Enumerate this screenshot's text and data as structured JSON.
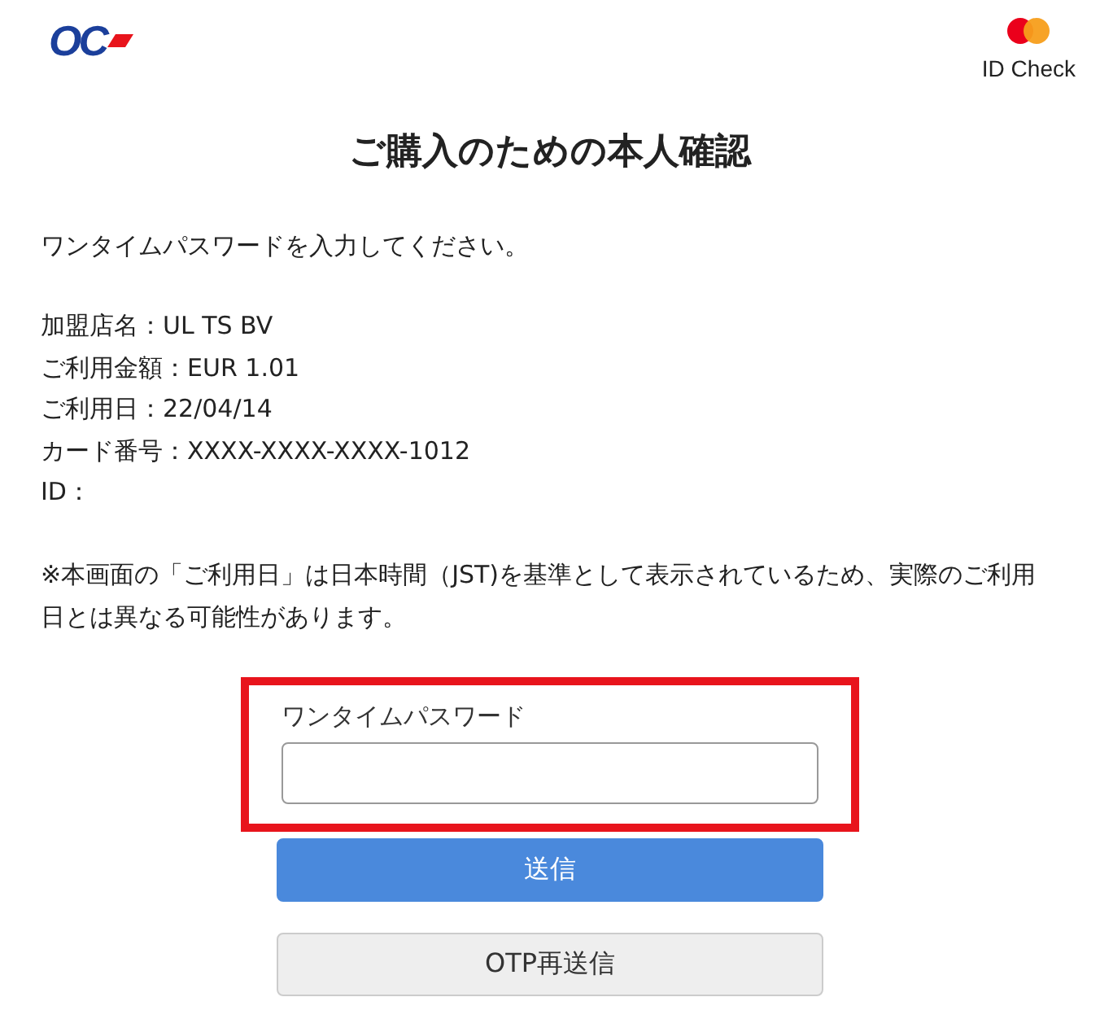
{
  "header": {
    "logo_text": "OC",
    "badge_text": "ID Check"
  },
  "title": "ご購入のための本人確認",
  "instruction": "ワンタイムパスワードを入力してください。",
  "details": [
    "加盟店名：UL TS BV",
    "ご利用金額：EUR 1.01",
    "ご利用日：22/04/14",
    "カード番号：XXXX-XXXX-XXXX-1012",
    "ID："
  ],
  "notice": "※本画面の「ご利用日」は日本時間（JST)を基準として表示されているため、実際のご利用日とは異なる可能性があります。",
  "form": {
    "label": "ワンタイムパスワード",
    "highlighted": true
  },
  "buttons": [
    {
      "kind": "primary",
      "label": "送信"
    },
    {
      "kind": "secondary",
      "label": "OTP再送信"
    }
  ]
}
